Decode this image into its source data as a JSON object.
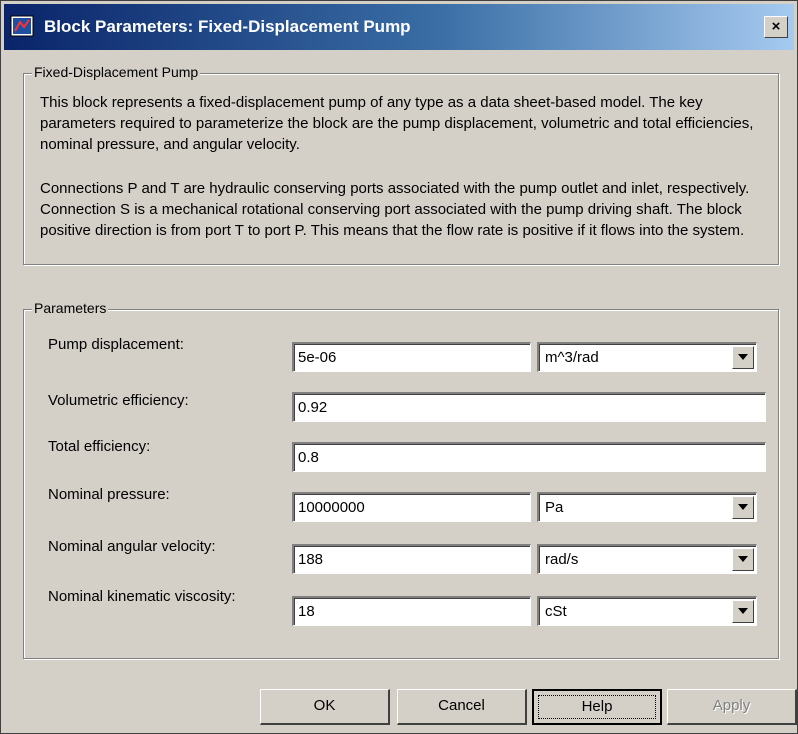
{
  "window": {
    "title": "Block Parameters: Fixed-Displacement  Pump",
    "close_label": "×"
  },
  "description_group": {
    "legend": "Fixed-Displacement Pump",
    "paragraph1": "This block represents  a  fixed-displacement pump of any type as a data sheet-based model. The key parameters required to parameterize the block are the pump displacement, volumetric and total efficiencies, nominal pressure, and angular velocity.",
    "paragraph2": "Connections P and T are hydraulic conserving ports associated with the pump outlet and inlet, respectively. Connection S is a mechanical rotational conserving port associated with the pump driving shaft. The block positive direction is from port T to port P. This means that the flow rate is positive if it flows into the system."
  },
  "parameters": {
    "legend": "Parameters",
    "pump_displacement": {
      "label": "Pump displacement:",
      "value": "5e-06",
      "unit": "m^3/rad"
    },
    "volumetric_efficiency": {
      "label": "Volumetric efficiency:",
      "value": "0.92"
    },
    "total_efficiency": {
      "label": "Total efficiency:",
      "value": "0.8"
    },
    "nominal_pressure": {
      "label": "Nominal pressure:",
      "value": "10000000",
      "unit": "Pa"
    },
    "nominal_angular_velocity": {
      "label": "Nominal angular velocity:",
      "value": "188",
      "unit": "rad/s"
    },
    "nominal_kinematic_viscosity": {
      "label": "Nominal kinematic viscosity:",
      "value": "18",
      "unit": "cSt"
    }
  },
  "buttons": {
    "ok": "OK",
    "cancel": "Cancel",
    "help": "Help",
    "apply": "Apply"
  },
  "colors": {
    "dialog_bg": "#d4d0c8",
    "title_gradient_start": "#0a246a",
    "title_gradient_end": "#a6caf0"
  }
}
